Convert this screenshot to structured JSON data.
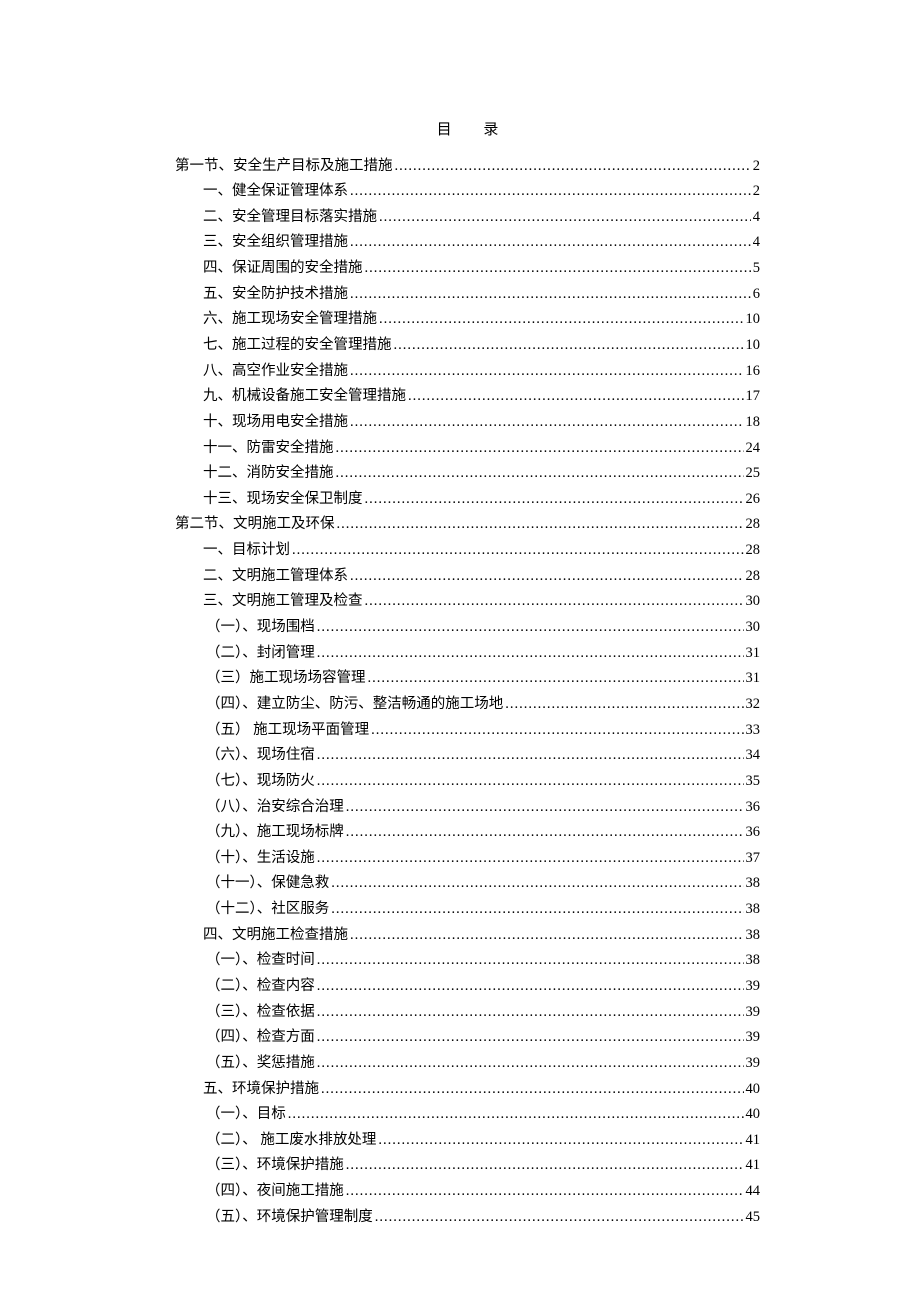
{
  "title": "目  录",
  "entries": [
    {
      "label": "第一节、安全生产目标及施工措施",
      "page": "2",
      "indent": 0
    },
    {
      "label": "一、健全保证管理体系",
      "page": "2",
      "indent": 1
    },
    {
      "label": "二、安全管理目标落实措施",
      "page": "4",
      "indent": 1
    },
    {
      "label": "三、安全组织管理措施",
      "page": "4",
      "indent": 1
    },
    {
      "label": "四、保证周围的安全措施",
      "page": "5",
      "indent": 1
    },
    {
      "label": "五、安全防护技术措施",
      "page": "6",
      "indent": 1
    },
    {
      "label": "六、施工现场安全管理措施",
      "page": "10",
      "indent": 1
    },
    {
      "label": "七、施工过程的安全管理措施",
      "page": "10",
      "indent": 1
    },
    {
      "label": "八、高空作业安全措施",
      "page": "16",
      "indent": 1
    },
    {
      "label": "九、机械设备施工安全管理措施",
      "page": "17",
      "indent": 1
    },
    {
      "label": "十、现场用电安全措施",
      "page": "18",
      "indent": 1
    },
    {
      "label": "十一、防雷安全措施",
      "page": "24",
      "indent": 1
    },
    {
      "label": "十二、消防安全措施",
      "page": "25",
      "indent": 1
    },
    {
      "label": "十三、现场安全保卫制度",
      "page": "26",
      "indent": 1
    },
    {
      "label": "第二节、文明施工及环保",
      "page": "28",
      "indent": 0
    },
    {
      "label": "一、目标计划",
      "page": "28",
      "indent": 1
    },
    {
      "label": "二、文明施工管理体系",
      "page": "28",
      "indent": 1
    },
    {
      "label": "三、文明施工管理及检查",
      "page": "30",
      "indent": 1
    },
    {
      "label": "（一）、现场围档",
      "page": "30",
      "indent": 2
    },
    {
      "label": "（二）、封闭管理",
      "page": "31",
      "indent": 2
    },
    {
      "label": "（三）施工现场场容管理",
      "page": "31",
      "indent": 2
    },
    {
      "label": "（四）、建立防尘、防污、整洁畅通的施工场地",
      "page": "32",
      "indent": 2
    },
    {
      "label": "（五）  施工现场平面管理",
      "page": "33",
      "indent": 2
    },
    {
      "label": "（六）、现场住宿",
      "page": "34",
      "indent": 2
    },
    {
      "label": "（七）、现场防火",
      "page": "35",
      "indent": 2
    },
    {
      "label": "（八）、治安综合治理",
      "page": "36",
      "indent": 2
    },
    {
      "label": "（九）、施工现场标牌",
      "page": "36",
      "indent": 2
    },
    {
      "label": "（十）、生活设施",
      "page": "37",
      "indent": 2
    },
    {
      "label": "（十一）、保健急救",
      "page": "38",
      "indent": 2
    },
    {
      "label": "（十二）、社区服务",
      "page": "38",
      "indent": 2
    },
    {
      "label": "四、文明施工检查措施",
      "page": "38",
      "indent": 1
    },
    {
      "label": "（一）、检查时间",
      "page": "38",
      "indent": 2
    },
    {
      "label": "（二）、检查内容",
      "page": "39",
      "indent": 2
    },
    {
      "label": "（三）、检查依据",
      "page": "39",
      "indent": 2
    },
    {
      "label": "（四）、检查方面",
      "page": "39",
      "indent": 2
    },
    {
      "label": "（五）、奖惩措施",
      "page": "39",
      "indent": 2
    },
    {
      "label": "五、环境保护措施",
      "page": "40",
      "indent": 1
    },
    {
      "label": "（一）、目标",
      "page": "40",
      "indent": 2
    },
    {
      "label": "（二）、 施工废水排放处理",
      "page": "41",
      "indent": 2
    },
    {
      "label": "（三）、环境保护措施",
      "page": "41",
      "indent": 2
    },
    {
      "label": "（四）、夜间施工措施",
      "page": "44",
      "indent": 2
    },
    {
      "label": "（五）、环境保护管理制度",
      "page": "45",
      "indent": 2
    }
  ]
}
